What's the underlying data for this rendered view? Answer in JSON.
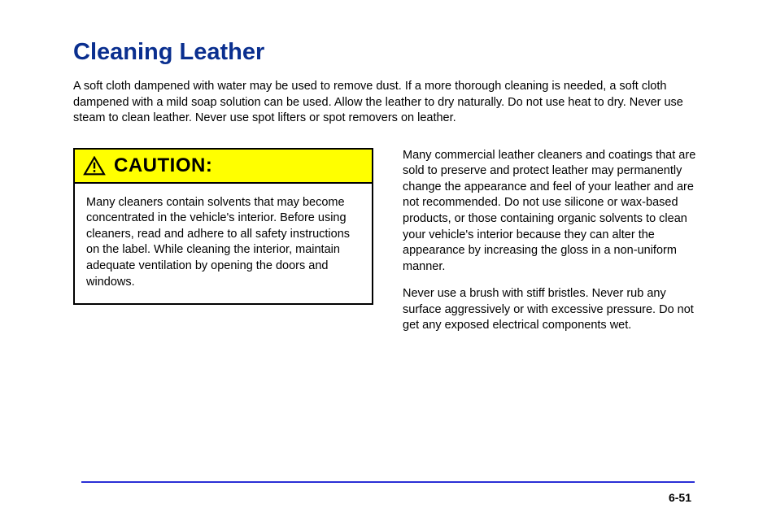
{
  "section": {
    "title": "Cleaning Leather",
    "intro": "A soft cloth dampened with water may be used to remove dust. If a more thorough cleaning is needed, a soft cloth dampened with a mild soap solution can be used. Allow the leather to dry naturally. Do not use heat to dry. Never use steam to clean leather. Never use spot lifters or spot removers on leather."
  },
  "caution": {
    "label": "CAUTION:",
    "body": "Many cleaners contain solvents that may become concentrated in the vehicle's interior. Before using cleaners, read and adhere to all safety instructions on the label. While cleaning the interior, maintain adequate ventilation by opening the doors and windows."
  },
  "right": {
    "p1": "Many commercial leather cleaners and coatings that are sold to preserve and protect leather may permanently change the appearance and feel of your leather and are not recommended. Do not use silicone or wax-based products, or those containing organic solvents to clean your vehicle's interior because they can alter the appearance by increasing the gloss in a non-uniform manner.",
    "p2": "Never use a brush with stiff bristles. Never rub any surface aggressively or with excessive pressure. Do not get any exposed electrical components wet."
  },
  "pageNumber": "6-51"
}
